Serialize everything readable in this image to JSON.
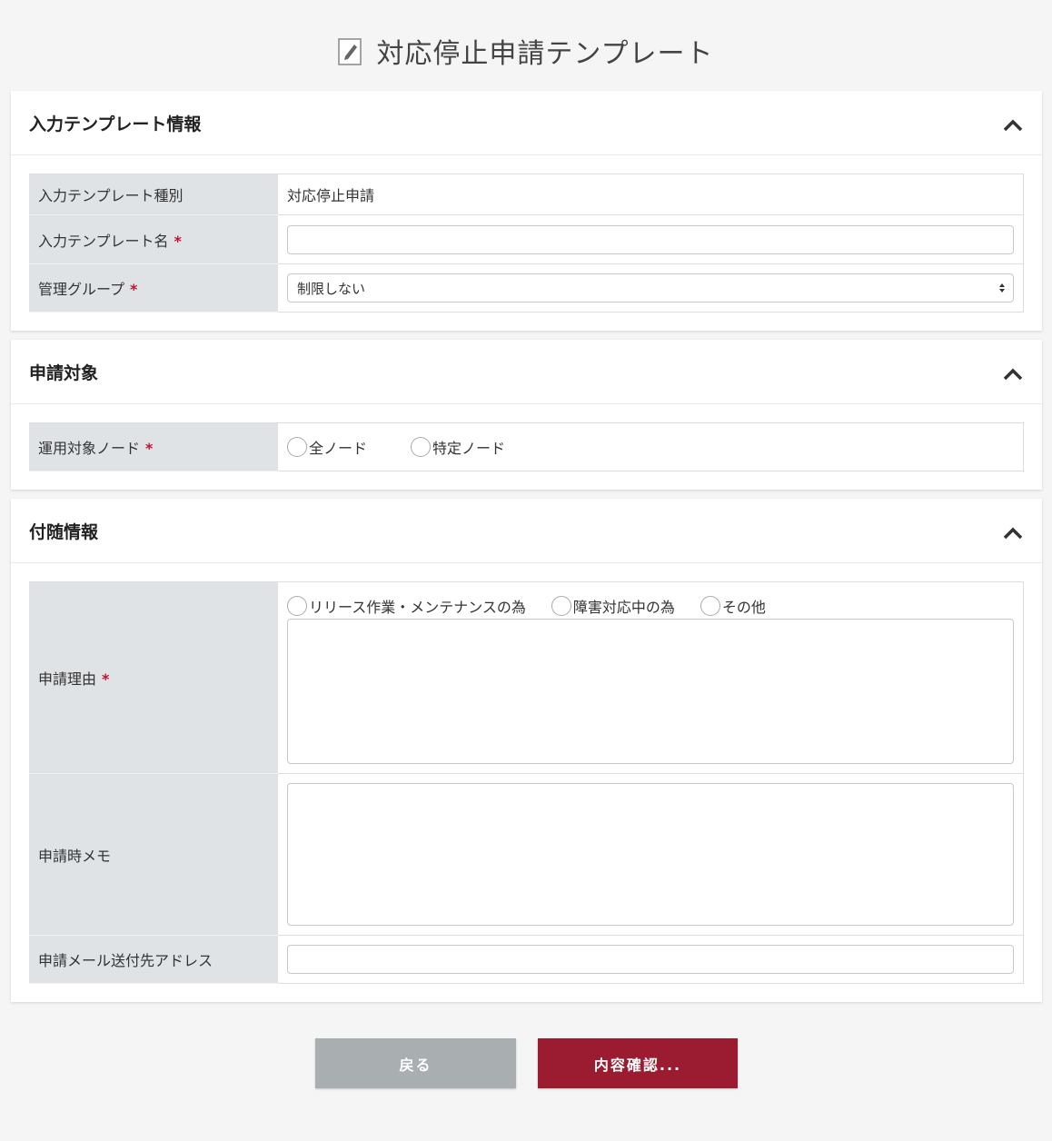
{
  "page": {
    "title": "対応停止申請テンプレート",
    "title_icon": "pencil-icon"
  },
  "section_template": {
    "header": "入力テンプレート情報",
    "type_label": "入力テンプレート種別",
    "type_value": "対応停止申請",
    "name_label": "入力テンプレート名",
    "name_value": "",
    "group_label": "管理グループ",
    "group_selected": "制限しない"
  },
  "section_target": {
    "header": "申請対象",
    "node_label": "運用対象ノード",
    "node_options": [
      "全ノード",
      "特定ノード"
    ]
  },
  "section_extra": {
    "header": "付随情報",
    "reason_label": "申請理由",
    "reason_options": [
      "リリース作業・メンテナンスの為",
      "障害対応中の為",
      "その他"
    ],
    "reason_text": "",
    "memo_label": "申請時メモ",
    "memo_text": "",
    "mail_label": "申請メール送付先アドレス",
    "mail_value": ""
  },
  "common": {
    "required_mark": "*"
  },
  "buttons": {
    "back": "戻る",
    "confirm": "内容確認..."
  },
  "colors": {
    "accent": "#9b1c31",
    "required": "#c41230",
    "label_bg": "#e0e3e6",
    "back_button": "#a9aeb0"
  }
}
